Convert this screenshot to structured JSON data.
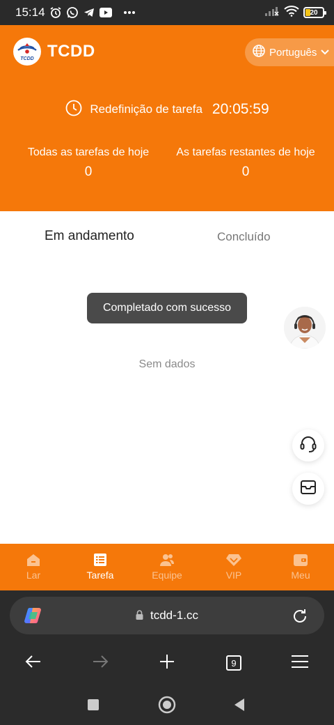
{
  "status_bar": {
    "time": "15:14",
    "battery": "20",
    "icons": [
      "alarm-icon",
      "whatsapp-icon",
      "telegram-icon",
      "youtube-icon",
      "more-icon",
      "signal-icon",
      "wifi-icon",
      "battery-icon"
    ]
  },
  "header": {
    "brand": "TCDD",
    "logo_text": "TCDD",
    "language": "Português",
    "reset_label": "Redefinição de tarefa",
    "reset_time": "20:05:59",
    "stats": [
      {
        "label": "Todas as tarefas de hoje",
        "value": "0"
      },
      {
        "label": "As tarefas restantes de hoje",
        "value": "0"
      }
    ]
  },
  "tabs": {
    "active": "Em andamento",
    "inactive": "Concluído"
  },
  "toast": "Completado com sucesso",
  "empty_text": "Sem dados",
  "tabbar": {
    "items": [
      {
        "label": "Lar",
        "icon": "home-icon",
        "active": false
      },
      {
        "label": "Tarefa",
        "icon": "task-list-icon",
        "active": true
      },
      {
        "label": "Equipe",
        "icon": "team-icon",
        "active": false
      },
      {
        "label": "VIP",
        "icon": "diamond-icon",
        "active": false
      },
      {
        "label": "Meu",
        "icon": "wallet-icon",
        "active": false
      }
    ]
  },
  "browser": {
    "url": "tcdd-1.cc",
    "tab_count": "9"
  },
  "colors": {
    "brand": "#f5780a",
    "toast": "#4a4a4a",
    "browser_bg": "#2b2b2b"
  }
}
